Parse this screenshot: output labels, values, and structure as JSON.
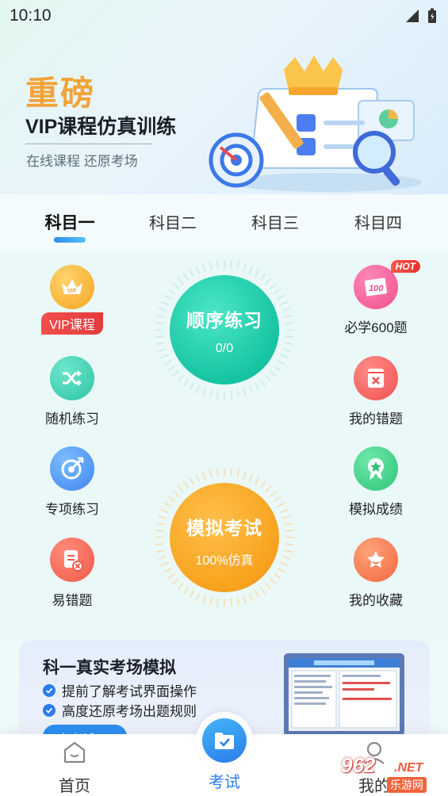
{
  "status_bar": {
    "time": "10:10"
  },
  "banner": {
    "title": "重磅",
    "subtitle": "VIP课程仿真训练",
    "caption": "在线课程  还原考场"
  },
  "tabs": [
    {
      "label": "科目一",
      "active": true
    },
    {
      "label": "科目二",
      "active": false
    },
    {
      "label": "科目三",
      "active": false
    },
    {
      "label": "科目四",
      "active": false
    }
  ],
  "features_left": [
    {
      "label": "VIP课程",
      "icon": "vip-crown-icon"
    },
    {
      "label": "随机练习",
      "icon": "shuffle-icon"
    },
    {
      "label": "专项练习",
      "icon": "target-icon"
    },
    {
      "label": "易错题",
      "icon": "error-doc-icon"
    }
  ],
  "features_right": [
    {
      "label": "必学600题",
      "icon": "score-100-icon",
      "badge": "HOT"
    },
    {
      "label": "我的错题",
      "icon": "wrong-book-icon"
    },
    {
      "label": "模拟成绩",
      "icon": "medal-icon"
    },
    {
      "label": "我的收藏",
      "icon": "star-icon"
    }
  ],
  "sequential": {
    "label": "顺序练习",
    "progress": "0/0"
  },
  "mock_exam": {
    "label": "模拟考试",
    "sub": "100%仿真"
  },
  "promo": {
    "title": "科一真实考场模拟",
    "points": [
      "提前了解考试界面操作",
      "高度还原考场出题规则"
    ],
    "button": "去考试"
  },
  "bottom_nav": [
    {
      "label": "首页",
      "icon": "home-icon"
    },
    {
      "label": "考试",
      "icon": "exam-icon",
      "active": true
    },
    {
      "label": "我的",
      "icon": "profile-icon"
    }
  ],
  "watermark": {
    "number": "962",
    "suffix": ".NET",
    "text": "乐游网"
  },
  "colors": {
    "accent": "#2d8ef0",
    "title_orange": "#f2a43a",
    "teal": "#1fd1b0",
    "exam_orange": "#f6a21c"
  }
}
